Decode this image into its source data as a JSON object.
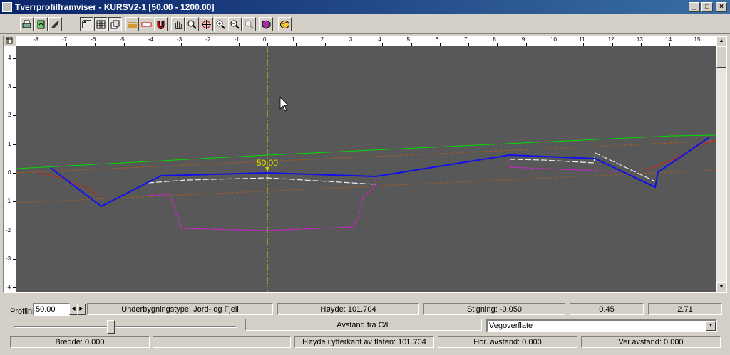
{
  "window": {
    "title": "Tverrprofilframviser - KURSV2-1  [50.00 - 1200.00]",
    "min_label": "_",
    "max_label": "□",
    "close_label": "×"
  },
  "toolbar": {
    "buttons": [
      "print-icon",
      "export-icon",
      "copy-icon",
      "ruler-grid-icon",
      "grid-icon",
      "layers-icon",
      "measure-icon",
      "text-scale-icon",
      "magnet-icon",
      "pan-hand-icon",
      "zoom-window-icon",
      "zoom-center-icon",
      "zoom-in-icon",
      "zoom-out-icon",
      "zoom-extents-icon",
      "book-icon",
      "palette-icon"
    ]
  },
  "ruler": {
    "x_ticks": [
      "-8",
      "-7",
      "-6",
      "-5",
      "-4",
      "-3",
      "-2",
      "-1",
      "0",
      "1",
      "2",
      "3",
      "4",
      "5",
      "6",
      "7",
      "8",
      "9",
      "10",
      "11",
      "12",
      "13",
      "14",
      "15"
    ],
    "y_ticks": [
      "4",
      "3",
      "2",
      "1",
      "0",
      "-1",
      "-2",
      "-3",
      "-4"
    ]
  },
  "plot": {
    "station_label": "50.00",
    "background": "#585858",
    "colors": {
      "terrain": "#00dd00",
      "road_surface": "#1010ee",
      "subgrade": "#cc22cc",
      "layer_dashed": "#f0f0f0",
      "centerline": "#d8d800",
      "red_terrain": "#cc2020",
      "slope_brown": "#a85a20"
    }
  },
  "status": {
    "profile_label": "Profilnr.",
    "profile_value": "50.00",
    "subgrade_type": "Underbygningstype: Jord- og Fjell",
    "height": "Høyde: 101.704",
    "gradient": "Stigning: -0.050",
    "value_a": "0.45",
    "value_b": "2.71",
    "distance_cl": "Avstand fra C/L",
    "surface_select": "Vegoverflate",
    "width": "Bredde: 0.000",
    "empty": "",
    "edge_height": "Høyde i ytterkant av flaten: 101.704",
    "hor_distance": "Hor. avstand: 0.000",
    "ver_distance": "Ver.avstand: 0.000"
  }
}
